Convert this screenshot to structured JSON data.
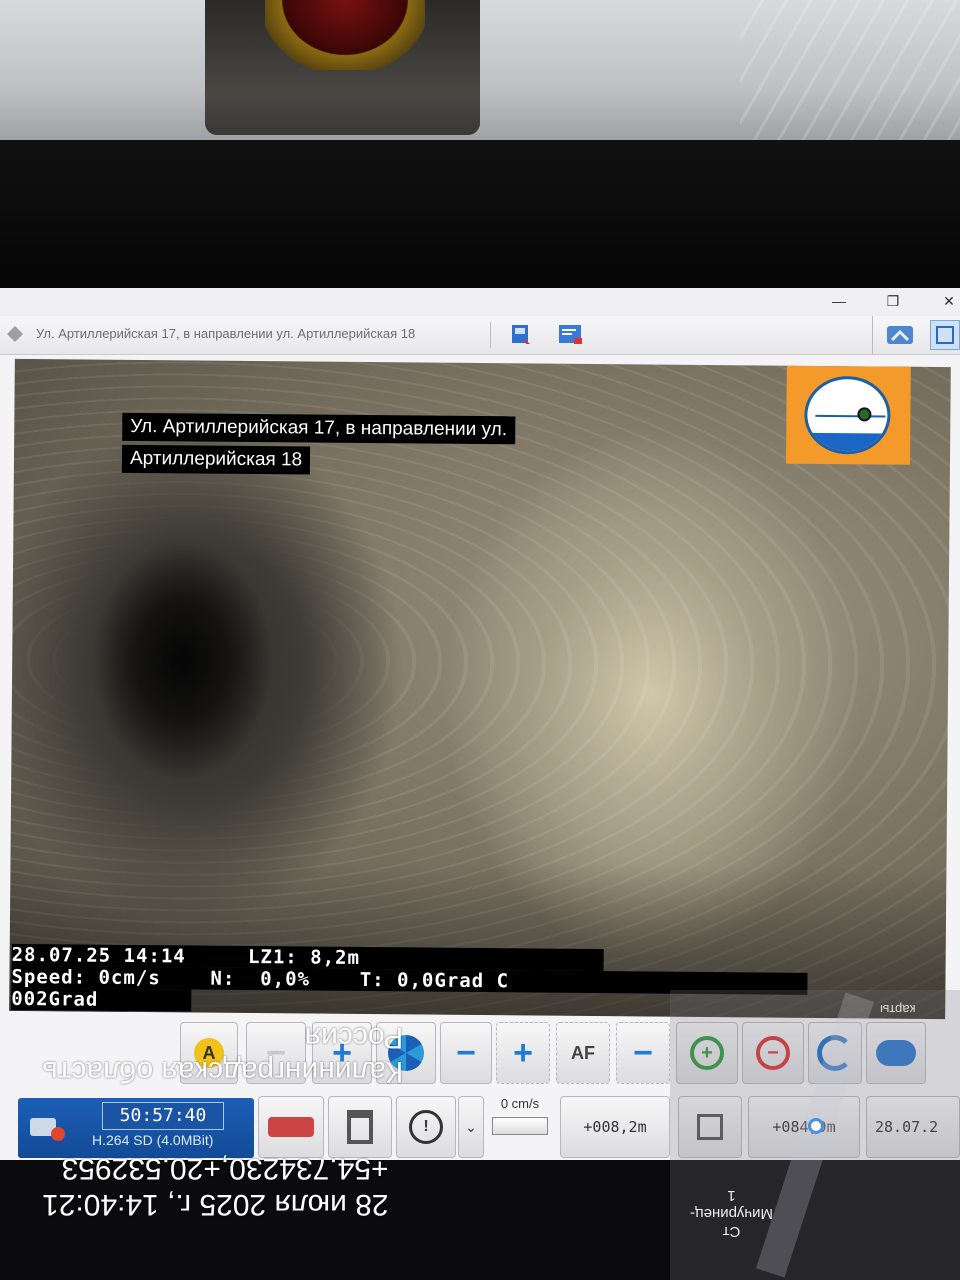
{
  "window": {
    "title": "Ул. Артиллерийская 17, в направлении ул. Артиллерийская 18",
    "controls": [
      "—",
      "❐",
      "✕"
    ]
  },
  "video": {
    "overlay_line1": "Ул. Артиллерийская 17, в направлении ул.",
    "overlay_line2": "Артиллерийская 18",
    "osd_row1": "28.07.25 14:14     LZ1: 8,2m",
    "osd_row2": "Speed: 0cm/s    N:  0,0%    T: 0,0Grad C",
    "osd_row3": "002Grad"
  },
  "controls": {
    "row1": [
      {
        "id": "brightness",
        "label": "A"
      },
      {
        "id": "minus-disabled",
        "label": "−"
      },
      {
        "id": "plus",
        "label": "+"
      },
      {
        "id": "aperture",
        "label": ""
      },
      {
        "id": "minus",
        "label": "−"
      },
      {
        "id": "focus-plus",
        "label": "+"
      },
      {
        "id": "autofocus",
        "label": "AF"
      },
      {
        "id": "focus-minus",
        "label": "−"
      },
      {
        "id": "zoom-in",
        "label": "+"
      },
      {
        "id": "zoom-out",
        "label": "−"
      },
      {
        "id": "rotate",
        "label": ""
      },
      {
        "id": "swap",
        "label": ""
      }
    ],
    "camera": {
      "time": "50:57:40",
      "codec": "H.264 SD (4.0MBit)"
    },
    "speed_label": "0 cm/s",
    "distance1": "+008,2m",
    "distance2": "+084,9m",
    "date_cell": "28.07.2"
  },
  "phone_overlay": {
    "location_line1": "Россия",
    "location_line2": "Калининградская область",
    "timestamp_line1": "+54.734230,+20.532953",
    "timestamp_line2": "28 июля 2025 г., 14:40:21",
    "map_label": "Ст\nМичуринец-\n1",
    "map_label2": "карты"
  }
}
